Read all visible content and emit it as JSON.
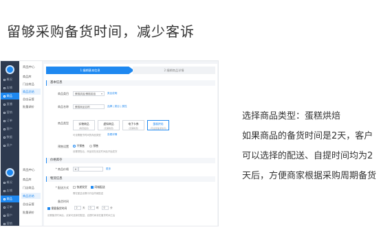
{
  "headline": "留够采购备货时间，减少客诉",
  "description": {
    "lines": [
      "选择商品类型：蛋糕烘焙",
      "如果商品的备货时间是2天，客户",
      "可以选择的配送、自提时间均为2",
      "天后，方便商家根据采购周期备货"
    ]
  },
  "screenshot": {
    "primary_nav": [
      {
        "label": "概况",
        "icon": "home-icon"
      },
      {
        "label": "店铺",
        "icon": "store-icon"
      },
      {
        "label": "商品",
        "icon": "goods-icon",
        "active": true
      },
      {
        "label": "直播",
        "icon": "live-icon"
      },
      {
        "label": "营销",
        "icon": "marketing-icon"
      },
      {
        "label": "订单",
        "icon": "order-icon"
      },
      {
        "label": "客户",
        "icon": "customer-icon"
      },
      {
        "label": "数据",
        "icon": "data-icon"
      },
      {
        "label": "资产",
        "icon": "asset-icon"
      }
    ],
    "primary_nav_2": [
      {
        "label": "概况",
        "icon": "home-icon"
      },
      {
        "label": "店铺",
        "icon": "store-icon"
      },
      {
        "label": "商品",
        "icon": "goods-icon",
        "active": true
      },
      {
        "label": "订单",
        "icon": "order-icon"
      },
      {
        "label": "客户",
        "icon": "customer-icon"
      },
      {
        "label": "营销",
        "icon": "marketing-icon"
      }
    ],
    "sub_nav": {
      "head": "商品中心",
      "items": [
        "商品库",
        "门店商品",
        "商品总结",
        "总店云管",
        "批量调价"
      ],
      "active_index": 2
    },
    "sub_nav_2": {
      "head": "商品中心",
      "items": [
        "商品库",
        "门店商品",
        "商品总结",
        "总店云管",
        "批量调价"
      ],
      "active_index": 2
    },
    "steps": [
      "1 编辑基本信息",
      "2 编辑商品详情"
    ],
    "sections": {
      "basic": "基本信息",
      "price": "价格库存",
      "logistics": "物流信息"
    },
    "form": {
      "category_label": "商品类目",
      "category_value": "蛋糕烘焙/蛋糕烘焙",
      "category_link": "类目说明",
      "name_label": "商品名称",
      "name_value": "蛋糕商品名称",
      "name_links": "品牌 | 类目 | 属性",
      "type_label": "商品类型",
      "types": [
        {
          "title": "实物商品",
          "sub": "(物流发货)"
        },
        {
          "title": "虚拟商品",
          "sub": "(无需物流)"
        },
        {
          "title": "电子卡券",
          "sub": "(无需物流)"
        },
        {
          "title": "蛋糕烘焙",
          "sub": "(可设置备货时间)",
          "active": true
        }
      ],
      "type_note": "可设置备货时间的商品类型",
      "type_link": "查看详情",
      "preorder_label": "预售设置",
      "preorder_options": [
        "不预售",
        "预售"
      ],
      "preorder_hint": "设置预售后，商品将在设定时间后开始发货",
      "price_label": "* 商品价格",
      "price_currency": "¥",
      "price_link": "更多",
      "delivery_label": "* 配送方式",
      "delivery_options": [
        {
          "label": "快递发货",
          "checked": false
        },
        {
          "label": "同城配送",
          "checked": true
        }
      ],
      "delivery_hint": "需在配送设置中开启同城配送",
      "stock_label": "备货时间",
      "stock_check": "需要备货时间",
      "stock_values": [
        {
          "value": "2",
          "unit": "天"
        },
        {
          "value": "0",
          "unit": "时"
        },
        {
          "value": "0",
          "unit": "分"
        }
      ],
      "stock_note": "设置备货时间后，买家可选择的配送、自提时间将在备货时间之后"
    }
  }
}
